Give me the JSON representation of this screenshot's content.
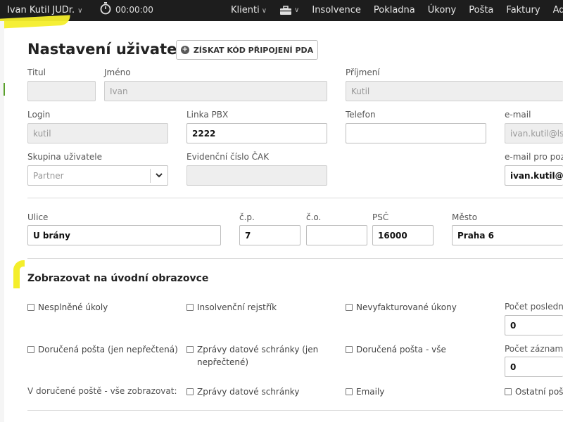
{
  "topbar": {
    "user": "Ivan Kutil JUDr.",
    "timer": "00:00:00",
    "nav": [
      "Klienti",
      "Insolvence",
      "Pokladna",
      "Úkony",
      "Pošta",
      "Faktury",
      "Adre"
    ]
  },
  "page": {
    "title": "Nastavení uživatele",
    "pda_button": "ZÍSKAT KÓD PŘIPOJENÍ PDA"
  },
  "form": {
    "titul_label": "Titul",
    "titul_value": "",
    "jmeno_label": "Jméno",
    "jmeno_value": "Ivan",
    "prijmeni_label": "Příjmení",
    "prijmeni_value": "Kutil",
    "login_label": "Login",
    "login_value": "kutil",
    "linka_label": "Linka PBX",
    "linka_value": "2222",
    "telefon_label": "Telefon",
    "telefon_value": "",
    "email_label": "e-mail",
    "email_value": "ivan.kutil@ls",
    "skupina_label": "Skupina uživatele",
    "skupina_value": "Partner",
    "cak_label": "Evidenční číslo ČAK",
    "cak_value": "",
    "email_pozv_label": "e-mail pro pozv",
    "email_pozv_value": "ivan.kutil@ls"
  },
  "address": {
    "ulice_label": "Ulice",
    "ulice_value": "U brány",
    "cp_label": "č.p.",
    "cp_value": "7",
    "co_label": "č.o.",
    "co_value": "",
    "psc_label": "PSČ",
    "psc_value": "16000",
    "mesto_label": "Město",
    "mesto_value": "Praha 6"
  },
  "home": {
    "title": "Zobrazovat na úvodní obrazovce",
    "cb_nesplnene": "Nesplněné úkoly",
    "cb_insolvencni": "Insolvenční rejstřík",
    "cb_nevyfakturovane": "Nevyfakturované úkony",
    "pocet_posledni_label": "Počet posledníc",
    "pocet_posledni_value": "0",
    "cb_dorucena_neprectena": "Doručená pošta (jen nepřečtená)",
    "cb_zpravy_neprectene": "Zprávy datové schránky (jen nepřečtené)",
    "cb_dorucena_vse": "Doručená pošta - vše",
    "pocet_zaznamu_label": "Počet záznamů",
    "pocet_zaznamu_value": "0",
    "v_dorucene_label": "V doručené poště - vše zobrazovat:",
    "cb_zpravy": "Zprávy datové schránky",
    "cb_emaily": "Emaily",
    "cb_ostatni": "Ostatní pošt"
  },
  "colors": {
    "topbar": "#1d1d1d",
    "highlight": "#f4ee2b",
    "disabled_field": "#eeeeee"
  }
}
